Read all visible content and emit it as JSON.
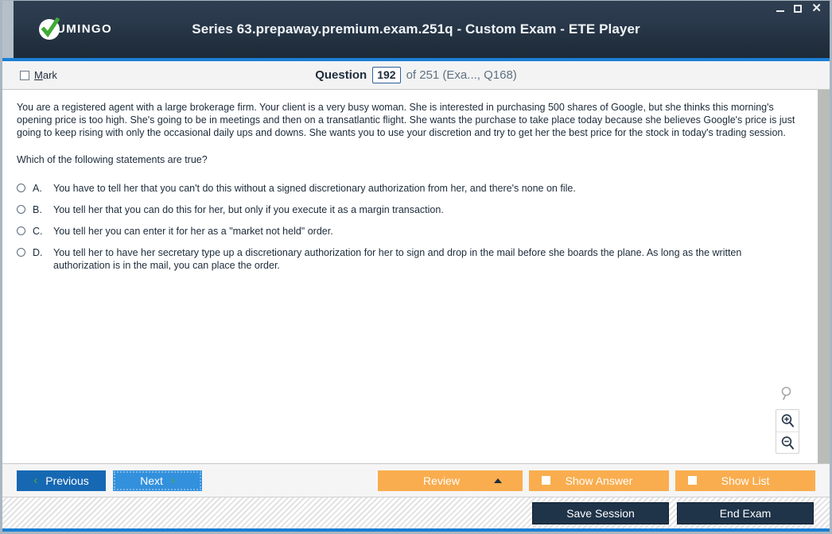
{
  "window": {
    "title": "Series 63.prepaway.premium.exam.251q - Custom Exam - ETE Player",
    "logo_text": "UMINGO",
    "controls": {
      "minimize": "–",
      "maximize": "□",
      "close": "✕"
    },
    "accent_color": "#1b7fd4",
    "titlebar_color": "#22303f"
  },
  "header": {
    "mark_label_prefix": "M",
    "mark_label_rest": "ark",
    "question_label": "Question",
    "question_number": "192",
    "of_text": "of 251 (Exa..., Q168)"
  },
  "question": {
    "stem": "You are a registered agent with a large brokerage firm. Your client is a very busy woman. She is interested in purchasing 500 shares of Google, but she thinks this morning's opening price is too high. She's going to be in meetings and then on a transatlantic flight. She wants the purchase to take place today because she believes Google's price is just going to keep rising with only the occasional daily ups and downs. She wants you to use your discretion and try to get her the best price for the stock in today's trading session.",
    "prompt": "Which of the following statements are true?",
    "options": [
      {
        "letter": "A.",
        "text": "You have to tell her that you can't do this without a signed discretionary authorization from her, and there's none on file."
      },
      {
        "letter": "B.",
        "text": "You tell her that you can do this for her, but only if you execute it as a margin transaction."
      },
      {
        "letter": "C.",
        "text": "You tell her you can enter it for her as a \"market not held\" order."
      },
      {
        "letter": "D.",
        "text": "You tell her to have her secretary type up a discretionary authorization for her to sign and drop in the mail before she boards the plane. As long as the written authorization is in the mail, you can place the order."
      }
    ]
  },
  "zoom_controls": {
    "fit": "search-icon",
    "zoom_in": "zoom-in-icon",
    "zoom_out": "zoom-out-icon"
  },
  "toolbar": {
    "previous": "Previous",
    "next": "Next",
    "review": "Review",
    "show_answer": "Show Answer",
    "show_list": "Show List",
    "chevron_left": "‹",
    "chevron_right": "›",
    "accent_orange": "#f9ad4e",
    "accent_blue": "#1668b3"
  },
  "statusbar": {
    "save_session": "Save Session",
    "end_exam": "End Exam"
  }
}
